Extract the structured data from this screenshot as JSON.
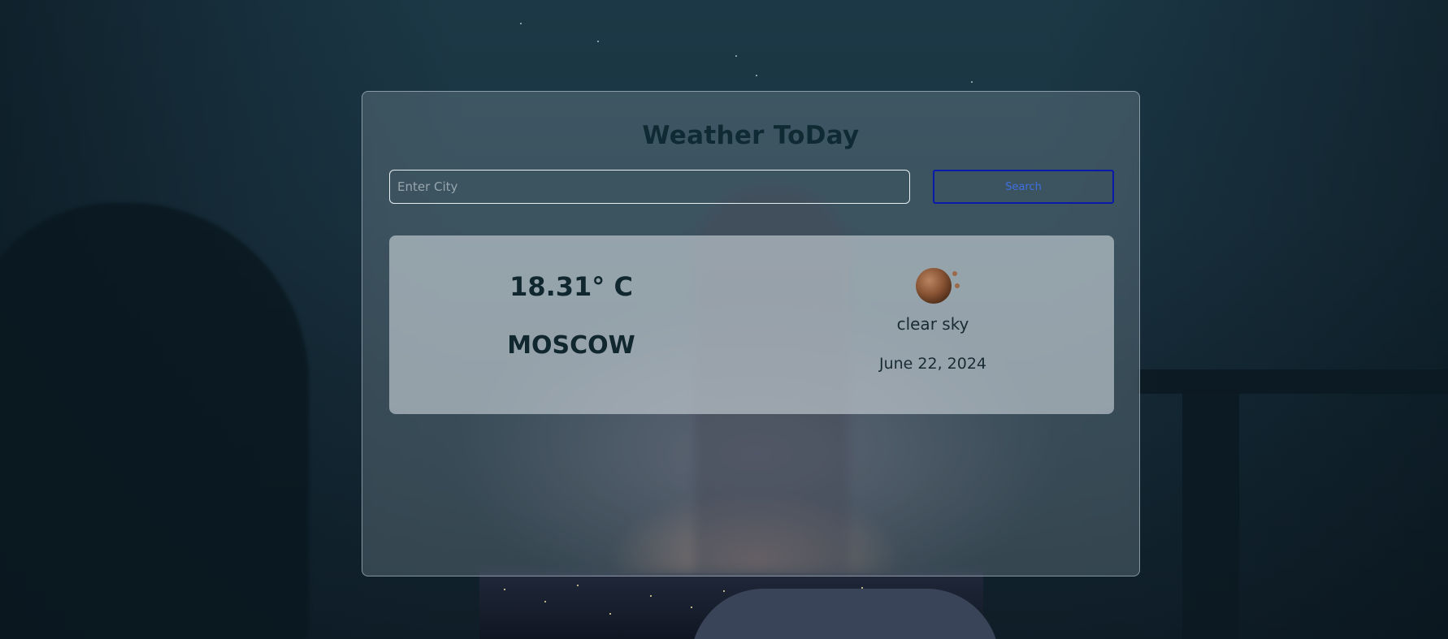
{
  "header": {
    "title": "Weather ToDay"
  },
  "search": {
    "placeholder": "Enter City",
    "value": "",
    "button_label": "Search"
  },
  "result": {
    "temperature": "18.31° C",
    "city": "MOSCOW",
    "icon": "sun-icon",
    "description": "clear sky",
    "date": "June 22, 2024"
  },
  "colors": {
    "title": "#0f2a33",
    "button_border": "#0a1aa8",
    "button_text": "#3f6fe0",
    "card_background": "#cdd7dc"
  }
}
